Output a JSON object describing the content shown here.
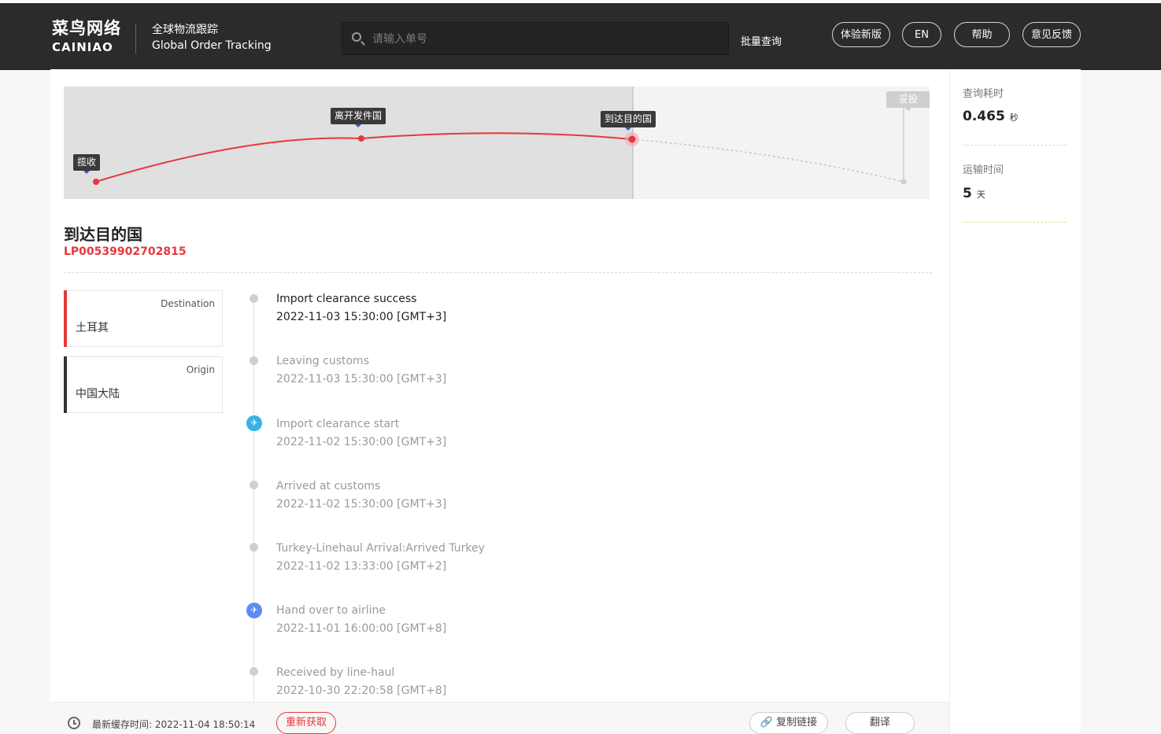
{
  "header": {
    "logo_cn": "菜鸟网络",
    "logo_en": "CAINIAO",
    "title_cn": "全球物流跟踪",
    "title_en": "Global Order Tracking",
    "search_placeholder": "请输入单号",
    "batch_query": "批量查询",
    "buttons": {
      "new_version": "体验新版",
      "lang": "EN",
      "help": "帮助",
      "feedback": "意见反馈"
    }
  },
  "progress_map": {
    "stages": [
      "揽收",
      "离开发件国",
      "到达目的国",
      "妥投"
    ],
    "current_stage": "到达目的国",
    "active_color": "#e4393c"
  },
  "package": {
    "status": "到达目的国",
    "tracking_number": "LP00539902702815"
  },
  "locations": {
    "destination": {
      "label": "Destination",
      "value": "土耳其",
      "color": "#e4393c"
    },
    "origin": {
      "label": "Origin",
      "value": "中国大陆",
      "color": "#333333"
    }
  },
  "events": [
    {
      "title": "Import clearance success",
      "time": "2022-11-03 15:30:00 [GMT+3]",
      "icon": "dot"
    },
    {
      "title": "Leaving customs",
      "time": "2022-11-03 15:30:00 [GMT+3]",
      "icon": "dot"
    },
    {
      "title": "Import clearance start",
      "time": "2022-11-02 15:30:00 [GMT+3]",
      "icon": "plane-landing-icon"
    },
    {
      "title": "Arrived at customs",
      "time": "2022-11-02 15:30:00 [GMT+3]",
      "icon": "dot"
    },
    {
      "title": "Turkey-Linehaul Arrival:Arrived Turkey",
      "time": "2022-11-02 13:33:00 [GMT+2]",
      "icon": "dot"
    },
    {
      "title": "Hand over to airline",
      "time": "2022-11-01 16:00:00 [GMT+8]",
      "icon": "plane-takeoff-icon"
    },
    {
      "title": "Received by line-haul",
      "time": "2022-10-30 22:20:58 [GMT+8]",
      "icon": "dot"
    }
  ],
  "footer": {
    "cache_label": "最新缓存时间: 2022-11-04 18:50:14",
    "refresh": "重新获取",
    "copy_link": "复制链接",
    "translate": "翻译"
  },
  "stats": {
    "query_time_label": "查询耗时",
    "query_time_value": "0.465",
    "query_time_unit": "秒",
    "transit_label": "运输时间",
    "transit_value": "5",
    "transit_unit": "天"
  }
}
